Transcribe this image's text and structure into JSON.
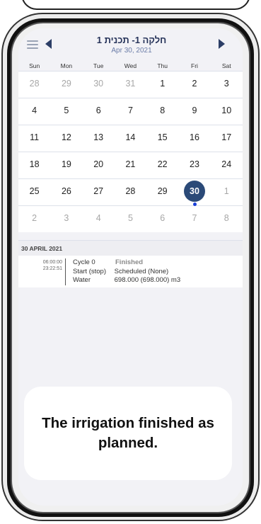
{
  "header": {
    "title": "חלקה 1- תכנית 1",
    "date": "Apr 30, 2021"
  },
  "calendar": {
    "weekdays": [
      "Sun",
      "Mon",
      "Tue",
      "Wed",
      "Thu",
      "Fri",
      "Sat"
    ],
    "weeks": [
      [
        "28",
        "29",
        "30",
        "31",
        "1",
        "2",
        "3"
      ],
      [
        "4",
        "5",
        "6",
        "7",
        "8",
        "9",
        "10"
      ],
      [
        "11",
        "12",
        "13",
        "14",
        "15",
        "16",
        "17"
      ],
      [
        "18",
        "19",
        "20",
        "21",
        "22",
        "23",
        "24"
      ],
      [
        "25",
        "26",
        "27",
        "28",
        "29",
        "30",
        "1"
      ],
      [
        "2",
        "3",
        "4",
        "5",
        "6",
        "7",
        "8"
      ]
    ],
    "selected_day": "30"
  },
  "schedule": {
    "section_title": "30 APRIL 2021",
    "event": {
      "start_time": "06:00:00",
      "end_time": "23:22:51",
      "cycle_label": "Cycle 0",
      "status": "Finished",
      "start_label": "Start (stop)",
      "start_value": "Scheduled (None)",
      "water_label": "Water",
      "water_value": "698.000 (698.000) m3"
    }
  },
  "callout": {
    "text": "The irrigation finished as planned."
  },
  "colors": {
    "accent": "#2b4a78",
    "dot": "#1a3fd8",
    "header_text": "#27345a"
  }
}
